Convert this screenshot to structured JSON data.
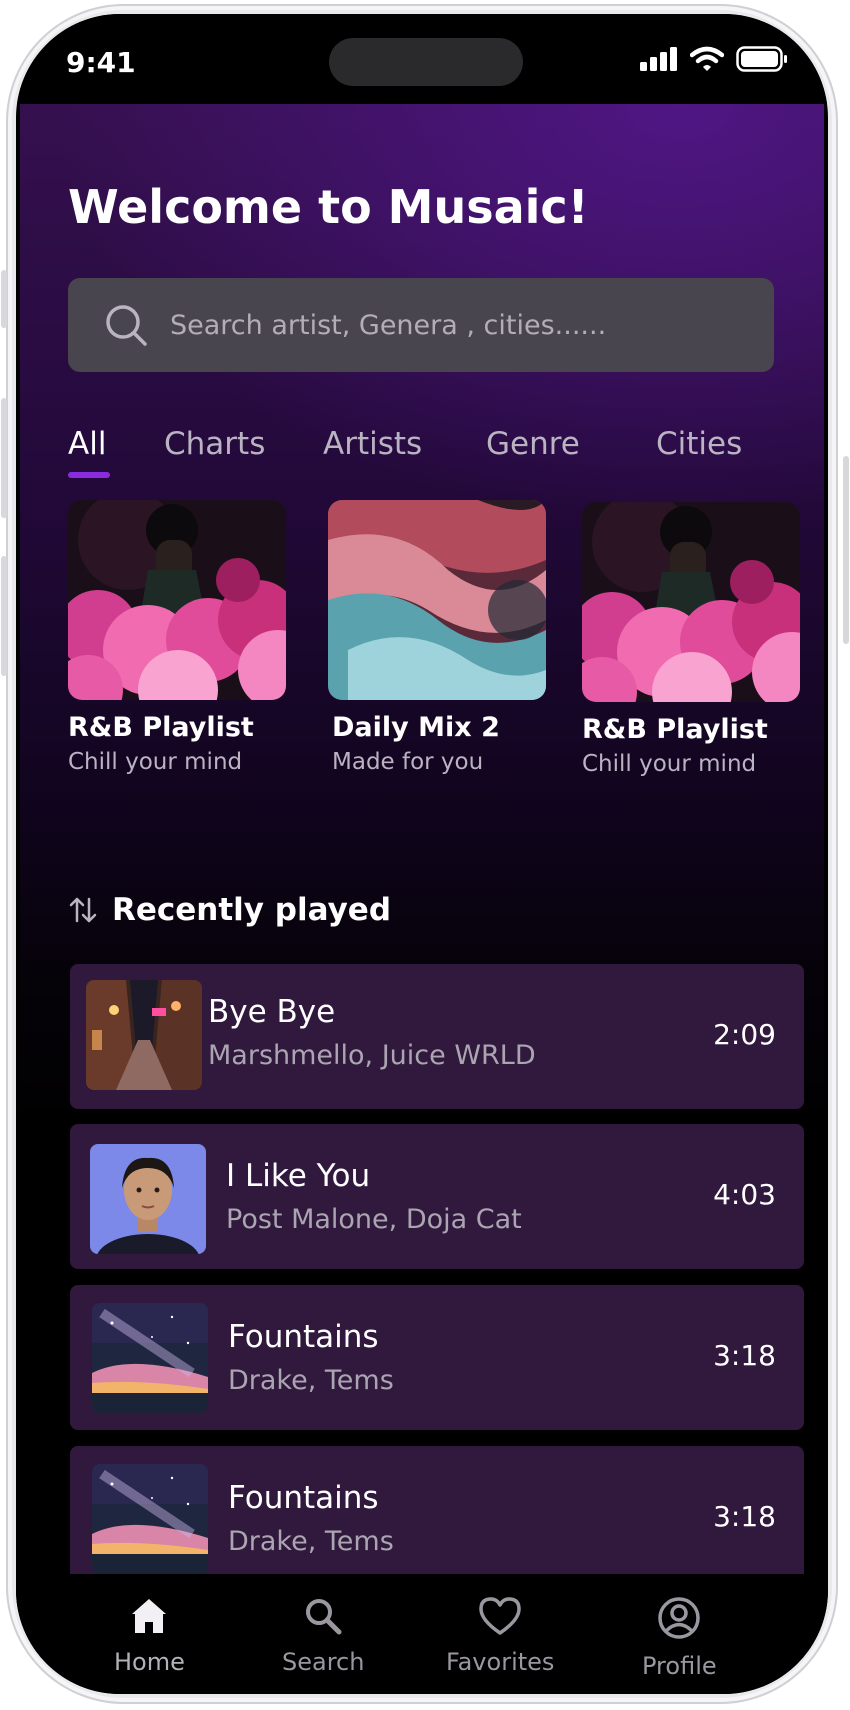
{
  "status_bar": {
    "time": "9:41"
  },
  "header": {
    "title": "Welcome to Musaic!"
  },
  "search": {
    "placeholder": "Search artist, Genera , cities......"
  },
  "tabs": [
    {
      "label": "All",
      "active": true
    },
    {
      "label": "Charts"
    },
    {
      "label": "Artists"
    },
    {
      "label": "Genre"
    },
    {
      "label": "Cities"
    }
  ],
  "playlists": [
    {
      "title": "R&B Playlist",
      "subtitle": "Chill your mind"
    },
    {
      "title": "Daily Mix 2",
      "subtitle": "Made for you"
    },
    {
      "title": "R&B Playlist",
      "subtitle": "Chill your mind"
    }
  ],
  "recent": {
    "title": "Recently played",
    "songs": [
      {
        "title": "Bye Bye",
        "artist": "Marshmello, Juice WRLD",
        "duration": "2:09"
      },
      {
        "title": "I Like You",
        "artist": "Post Malone, Doja Cat",
        "duration": "4:03"
      },
      {
        "title": "Fountains",
        "artist": "Drake, Tems",
        "duration": "3:18"
      },
      {
        "title": "Fountains",
        "artist": "Drake, Tems",
        "duration": "3:18"
      }
    ]
  },
  "nav": [
    {
      "label": "Home",
      "icon": "home-icon",
      "active": true
    },
    {
      "label": "Search",
      "icon": "search-icon"
    },
    {
      "label": "Favorites",
      "icon": "heart-icon"
    },
    {
      "label": "Profile",
      "icon": "user-circle-icon"
    }
  ],
  "colors": {
    "accent": "#8a2be2",
    "card_bg": "#30193d",
    "search_bg": "#49454e"
  }
}
